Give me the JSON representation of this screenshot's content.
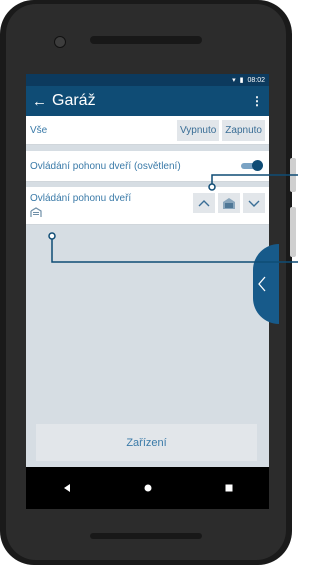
{
  "status_bar": {
    "time": "08:02"
  },
  "app_bar": {
    "back_icon": "arrow-left-icon",
    "title": "Garáž",
    "menu_icon": "more-vert-icon"
  },
  "all_row": {
    "label": "Vše",
    "off_label": "Vypnuto",
    "on_label": "Zapnuto"
  },
  "toggle_row": {
    "label": "Ovládání pohonu dveří (osvětlení)",
    "state": "on"
  },
  "door_row": {
    "label": "Ovládání pohonu dveří",
    "buttons": [
      "chevron-up-icon",
      "garage-icon",
      "chevron-down-icon"
    ]
  },
  "bottom_button": {
    "label": "Zařízení"
  },
  "nav_bar": {
    "icons": [
      "back-triangle-icon",
      "home-circle-icon",
      "recents-square-icon"
    ]
  },
  "colors": {
    "app_bar": "#0f4c75",
    "status_bar": "#0c3a5e",
    "accent_text": "#3a7aa8",
    "background": "#d6dde3",
    "callout": "#0f4c75"
  }
}
